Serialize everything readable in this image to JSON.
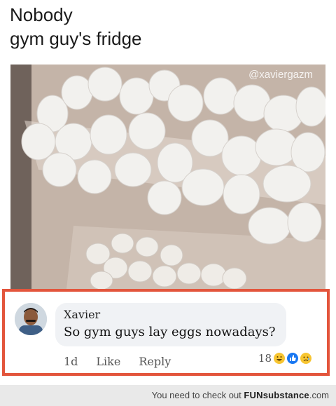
{
  "caption": {
    "line1": "Nobody",
    "line2": "gym guy's fridge"
  },
  "photo": {
    "watermark": "@xaviergazm"
  },
  "comment": {
    "author": "Xavier",
    "text": "So gym guys lay eggs nowadays?",
    "time": "1d",
    "like_label": "Like",
    "reply_label": "Reply",
    "reaction_count": "18",
    "reactions": [
      "haha-icon",
      "like-icon",
      "sad-icon"
    ],
    "highlight_color": "#e3553c"
  },
  "footer": {
    "text": "You need to check out ",
    "brand": "FUNsubstance",
    "suffix": ".com"
  }
}
